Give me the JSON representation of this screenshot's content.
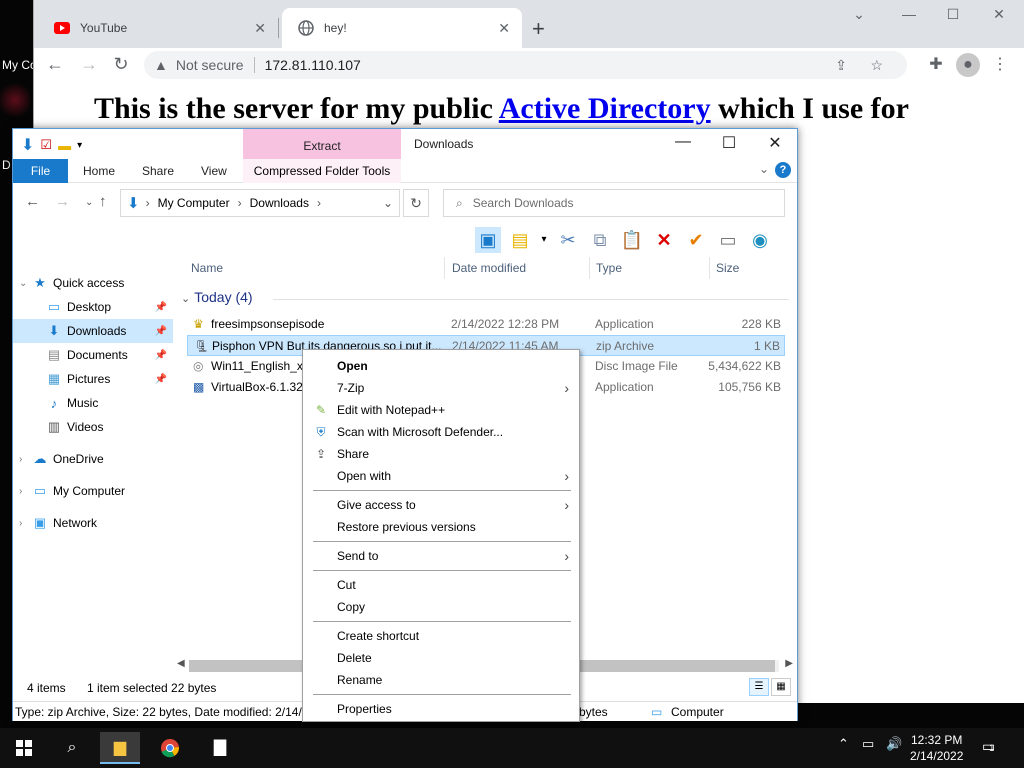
{
  "desktop": {
    "icon_label": "My Co",
    "icon_label2": "D"
  },
  "browser": {
    "tabs": [
      {
        "title": "YouTube",
        "favicon": "youtube-icon"
      },
      {
        "title": "hey!",
        "favicon": "globe-icon"
      }
    ],
    "address": {
      "security_text": "Not secure",
      "url": "172.81.110.107"
    },
    "page": {
      "heading_before": "This is the server for my public ",
      "heading_link": "Active Directory",
      "heading_after": " which I use for"
    }
  },
  "explorer": {
    "title": "Downloads",
    "contextual_tab": "Extract",
    "contextual_tools": "Compressed Folder Tools",
    "ribbon_tabs": [
      "File",
      "Home",
      "Share",
      "View"
    ],
    "breadcrumb": [
      "My Computer",
      "Downloads"
    ],
    "search_placeholder": "Search Downloads",
    "nav": [
      {
        "label": "Quick access",
        "icon": "star-icon",
        "pinned": false,
        "selected": false
      },
      {
        "label": "Desktop",
        "icon": "desktop-icon",
        "pinned": true,
        "selected": false
      },
      {
        "label": "Downloads",
        "icon": "download-icon",
        "pinned": true,
        "selected": true
      },
      {
        "label": "Documents",
        "icon": "document-icon",
        "pinned": true,
        "selected": false
      },
      {
        "label": "Pictures",
        "icon": "pictures-icon",
        "pinned": true,
        "selected": false
      },
      {
        "label": "Music",
        "icon": "music-icon",
        "pinned": false,
        "selected": false
      },
      {
        "label": "Videos",
        "icon": "video-icon",
        "pinned": false,
        "selected": false
      },
      {
        "label": "OneDrive",
        "icon": "cloud-icon",
        "pinned": false,
        "selected": false
      },
      {
        "label": "My Computer",
        "icon": "computer-icon",
        "pinned": false,
        "selected": false
      },
      {
        "label": "Network",
        "icon": "network-icon",
        "pinned": false,
        "selected": false
      }
    ],
    "columns": [
      "Name",
      "Date modified",
      "Type",
      "Size"
    ],
    "group": "Today (4)",
    "files": [
      {
        "name": "freesimpsonsepisode",
        "date": "2/14/2022 12:28 PM",
        "type": "Application",
        "size": "228 KB",
        "selected": false
      },
      {
        "name": "Pisphon VPN But its dangerous so i put it...",
        "date": "2/14/2022 11:45 AM",
        "type": "zip Archive",
        "size": "1 KB",
        "selected": true
      },
      {
        "name": "Win11_English_x6",
        "date": "",
        "type": "Disc Image File",
        "size": "5,434,622 KB",
        "selected": false
      },
      {
        "name": "VirtualBox-6.1.32-",
        "date": "",
        "type": "Application",
        "size": "105,756 KB",
        "selected": false
      }
    ],
    "status": {
      "count": "4 items",
      "selection": "1 item selected  22 bytes"
    },
    "details": {
      "text": "Type: zip Archive, Size: 22 bytes, Date modified: 2/14/20",
      "size": "bytes",
      "location": "Computer"
    }
  },
  "context_menu": {
    "items": [
      {
        "label": "Open",
        "bold": true,
        "submenu": false,
        "icon": ""
      },
      {
        "label": "7-Zip",
        "bold": false,
        "submenu": true,
        "icon": ""
      },
      {
        "label": "Edit with Notepad++",
        "bold": false,
        "submenu": false,
        "icon": "notepad-icon"
      },
      {
        "label": "Scan with Microsoft Defender...",
        "bold": false,
        "submenu": false,
        "icon": "defender-icon"
      },
      {
        "label": "Share",
        "bold": false,
        "submenu": false,
        "icon": "share-icon"
      },
      {
        "label": "Open with",
        "bold": false,
        "submenu": true,
        "icon": ""
      },
      {
        "label": "Give access to",
        "bold": false,
        "submenu": true,
        "icon": ""
      },
      {
        "label": "Restore previous versions",
        "bold": false,
        "submenu": false,
        "icon": ""
      },
      {
        "label": "Send to",
        "bold": false,
        "submenu": true,
        "icon": ""
      },
      {
        "label": "Cut",
        "bold": false,
        "submenu": false,
        "icon": ""
      },
      {
        "label": "Copy",
        "bold": false,
        "submenu": false,
        "icon": ""
      },
      {
        "label": "Create shortcut",
        "bold": false,
        "submenu": false,
        "icon": ""
      },
      {
        "label": "Delete",
        "bold": false,
        "submenu": false,
        "icon": ""
      },
      {
        "label": "Rename",
        "bold": false,
        "submenu": false,
        "icon": ""
      },
      {
        "label": "Properties",
        "bold": false,
        "submenu": false,
        "icon": ""
      }
    ]
  },
  "taskbar": {
    "time": "12:32 PM",
    "date": "2/14/2022",
    "notification_count": "1"
  },
  "colors": {
    "accent": "#1979ca",
    "selection": "#cce8ff",
    "extract_tab": "#f7c2e0",
    "link": "#0000ee"
  }
}
